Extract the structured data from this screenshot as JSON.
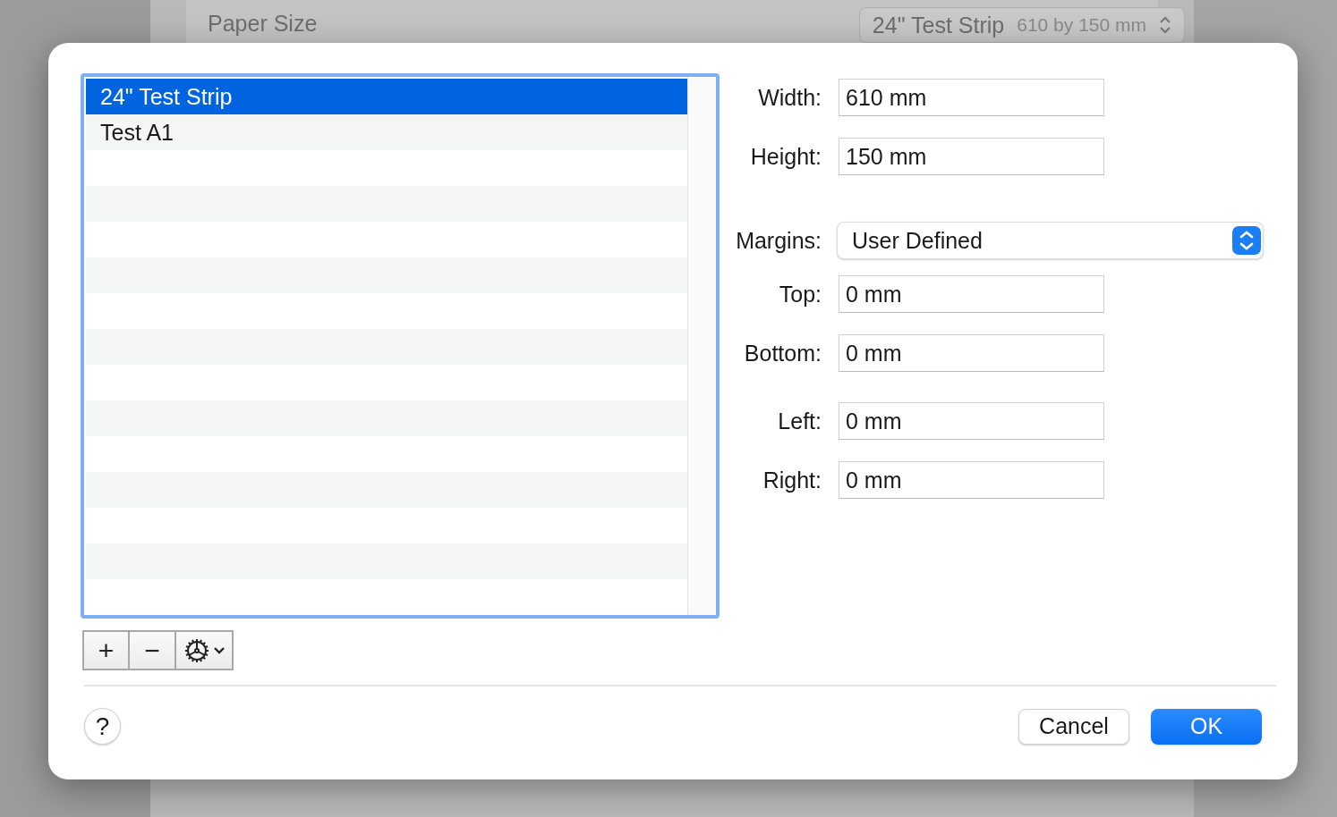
{
  "background": {
    "label": "Paper Size",
    "popup": {
      "value": "24\" Test Strip",
      "detail": "610 by 150 mm"
    }
  },
  "paper_list": [
    {
      "label": "24\" Test Strip",
      "selected": true
    },
    {
      "label": "Test A1",
      "selected": false
    }
  ],
  "list_tools": [
    {
      "kind": "add",
      "label": "+"
    },
    {
      "kind": "remove",
      "label": "−"
    },
    {
      "kind": "actions"
    }
  ],
  "form": [
    {
      "kind": "field",
      "label": "Width:",
      "value": "610 mm"
    },
    {
      "kind": "field",
      "label": "Height:",
      "value": "150 mm"
    },
    {
      "kind": "popup",
      "label": "Margins:",
      "value": "User Defined"
    },
    {
      "kind": "field",
      "label": "Top:",
      "value": "0 mm"
    },
    {
      "kind": "field",
      "label": "Bottom:",
      "value": "0 mm"
    },
    {
      "kind": "field",
      "label": "Left:",
      "value": "0 mm"
    },
    {
      "kind": "field",
      "label": "Right:",
      "value": "0 mm"
    }
  ],
  "help": {
    "label": "?"
  },
  "buttons": [
    {
      "label": "Cancel",
      "default": false
    },
    {
      "label": "OK",
      "default": true
    }
  ]
}
